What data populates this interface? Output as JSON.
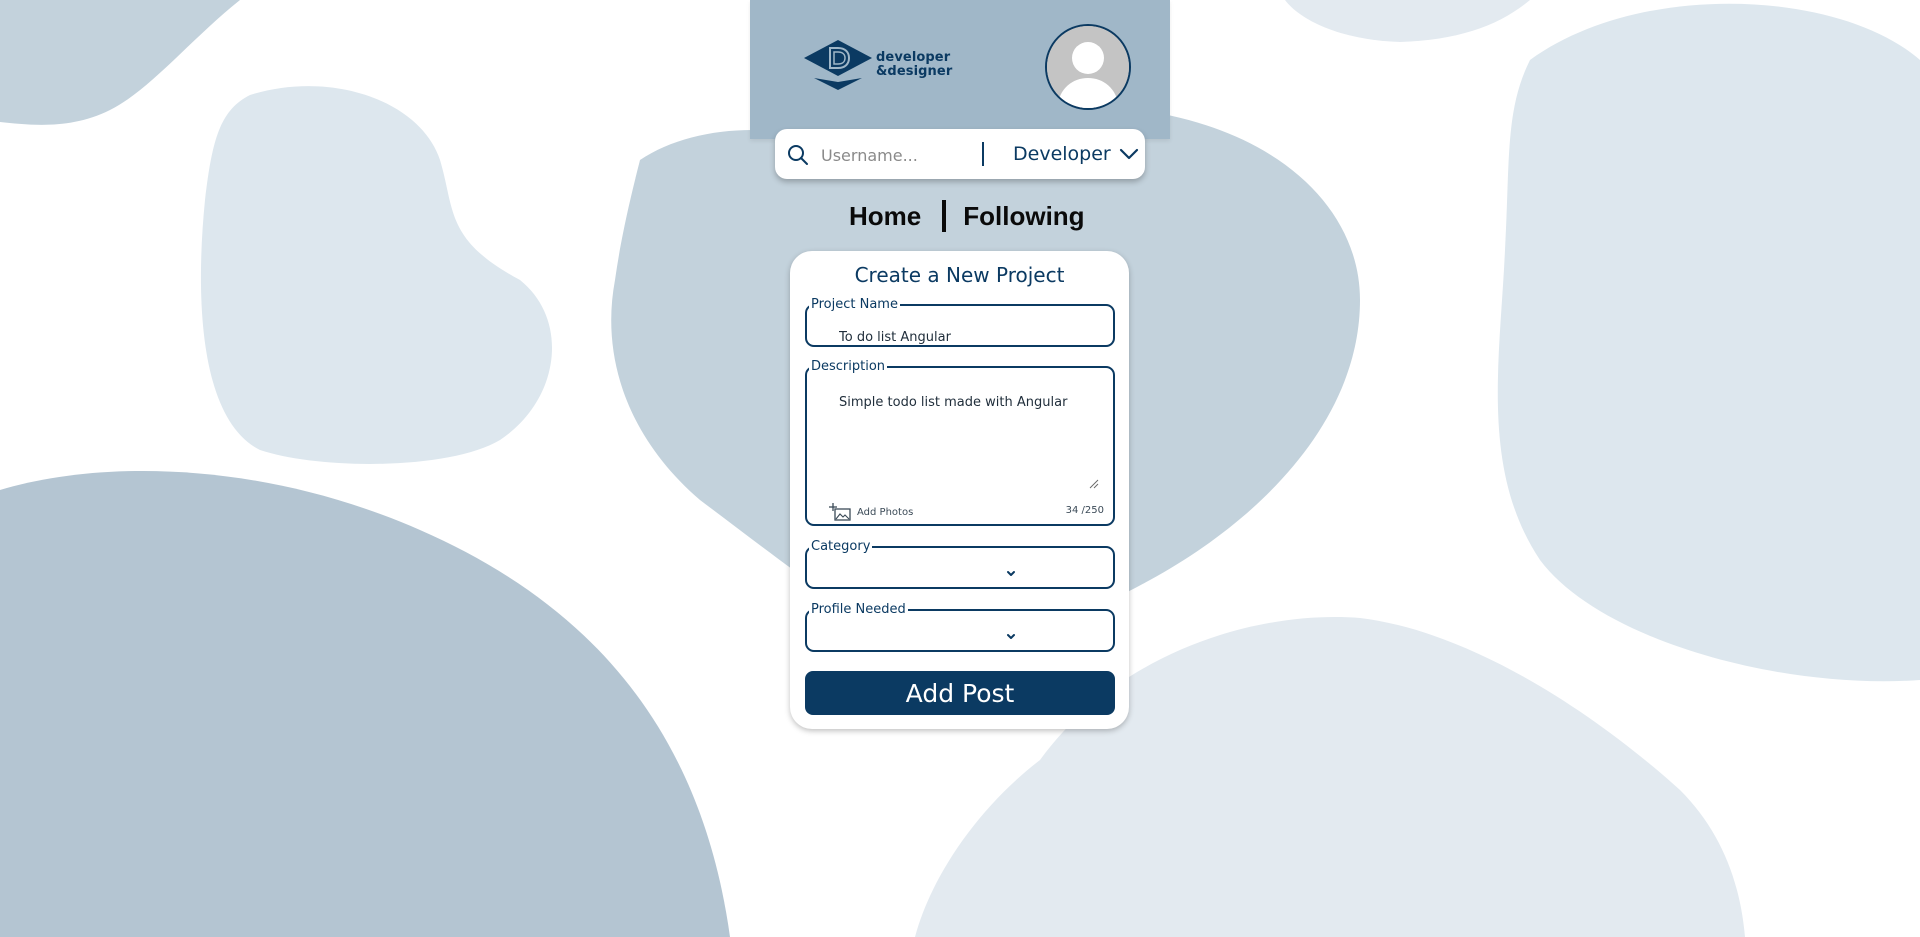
{
  "brand": {
    "line1": "developer",
    "line2": "&designer",
    "logo_letter": "D"
  },
  "search": {
    "placeholder": "Username...",
    "role_selected": "Developer"
  },
  "nav": {
    "home": "Home",
    "following": "Following"
  },
  "form": {
    "title": "Create a New Project",
    "project_name_label": "Project Name",
    "project_name_value": "To do list Angular",
    "description_label": "Description",
    "description_value": "Simple todo list made with Angular",
    "add_photos_label": "Add Photos",
    "char_count": "34 /250",
    "category_label": "Category",
    "profile_label": "Profile Needed",
    "submit_label": "Add Post"
  },
  "colors": {
    "primary": "#0b3a62",
    "header_bg": "#a0b7c8",
    "blob_dark": "#b4c5d2",
    "blob_mid": "#c3d2dc",
    "blob_light": "#dde7ee",
    "blob_pale": "#e3eaf0"
  },
  "icons": {
    "search": "search-icon",
    "role_dropdown": "chevron-down-icon",
    "avatar": "user-avatar-icon",
    "add_photos": "add-image-icon",
    "select_dropdown": "chevron-down-icon"
  }
}
